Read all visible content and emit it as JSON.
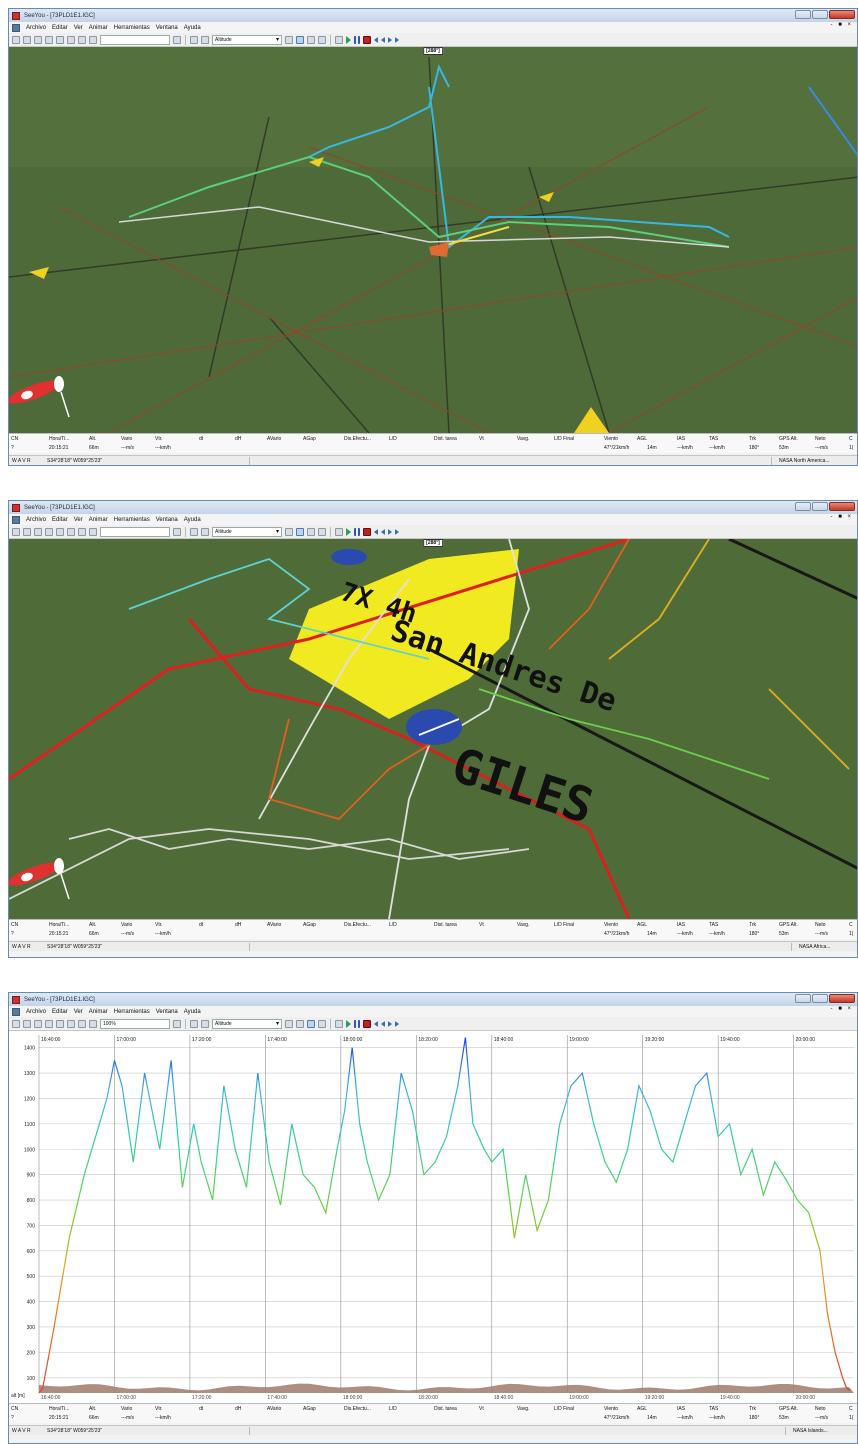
{
  "window": {
    "title": "SeeYou - [73PLD1E1.IGC]",
    "menu": [
      "Archivo",
      "Editar",
      "Ver",
      "Animar",
      "Herramientas",
      "Ventana",
      "Ayuda"
    ],
    "mdi_controls": "- ■ ×",
    "altitude_select": "Altitude",
    "zoom_value": "100%",
    "heading_label": "[288°]"
  },
  "flight_grid": {
    "headers": [
      "CN",
      "Hora/Ti...",
      "Alt.",
      "Vario",
      "Vtr.",
      "dt",
      "dH",
      "AVario",
      "AGap",
      "Dis.Efectu...",
      "L/D",
      "Dist. tarea",
      "Vt",
      "Vavg.",
      "L/D Final",
      "Viento",
      "AGL",
      "IAS",
      "TAS",
      "Trk",
      "GPS Alt.",
      "Neto",
      "C"
    ],
    "row": [
      "?",
      "20:15:21",
      "66m",
      "---m/s",
      "---km/h",
      "",
      "",
      "",
      "",
      "",
      "",
      "",
      "",
      "",
      "",
      "47°/21km/h",
      "14m",
      "---km/h",
      "---km/h",
      "180°",
      "53m",
      "---m/s",
      "1("
    ]
  },
  "status": {
    "modes": "W  A  V  R",
    "coords": "S34°28'18\"  W059°25'23\"",
    "panels": [
      "NASA North America...",
      "NASA Africa...",
      "NASA Islands..."
    ]
  },
  "map_labels": {
    "big1": "7X 4h",
    "big2": "San Andres De",
    "big3": "GILES"
  },
  "chart_data": {
    "type": "line",
    "title": "",
    "xlabel": "",
    "ylabel": "alt [m]",
    "x_ticks": [
      "16:40:00",
      "17:00:00",
      "17:20:00",
      "17:40:00",
      "18:00:00",
      "18:20:00",
      "18:40:00",
      "19:00:00",
      "19:20:00",
      "19:40:00",
      "20:00:00"
    ],
    "y_ticks": [
      100,
      200,
      300,
      400,
      500,
      600,
      700,
      800,
      900,
      1000,
      1100,
      1200,
      1300,
      1400
    ],
    "ylim": [
      40,
      1450
    ],
    "grid": true,
    "x": [
      "16:40",
      "16:41",
      "16:44",
      "16:48",
      "16:52",
      "16:54",
      "16:56",
      "16:58",
      "17:00",
      "17:02",
      "17:05",
      "17:08",
      "17:10",
      "17:12",
      "17:15",
      "17:18",
      "17:21",
      "17:23",
      "17:26",
      "17:29",
      "17:32",
      "17:35",
      "17:38",
      "17:41",
      "17:44",
      "17:47",
      "17:50",
      "17:53",
      "17:56",
      "17:59",
      "18:01",
      "18:03",
      "18:05",
      "18:07",
      "18:10",
      "18:13",
      "18:16",
      "18:19",
      "18:22",
      "18:25",
      "18:28",
      "18:31",
      "18:33",
      "18:35",
      "18:38",
      "18:40",
      "18:43",
      "18:46",
      "18:49",
      "18:52",
      "18:55",
      "18:58",
      "19:01",
      "19:04",
      "19:07",
      "19:10",
      "19:13",
      "19:16",
      "19:19",
      "19:22",
      "19:25",
      "19:28",
      "19:31",
      "19:34",
      "19:37",
      "19:40",
      "19:43",
      "19:46",
      "19:49",
      "19:52",
      "19:55",
      "19:58",
      "20:01",
      "20:04",
      "20:07",
      "20:09",
      "20:11",
      "20:13",
      "20:14",
      "20:15"
    ],
    "series": [
      {
        "values": [
          40,
          60,
          300,
          650,
          900,
          1000,
          1100,
          1200,
          1350,
          1250,
          950,
          1300,
          1150,
          1000,
          1350,
          850,
          1100,
          950,
          800,
          1250,
          1000,
          850,
          1300,
          950,
          780,
          1100,
          900,
          850,
          750,
          1000,
          1150,
          1400,
          1100,
          950,
          800,
          900,
          1300,
          1150,
          900,
          950,
          1050,
          1250,
          1440,
          1100,
          1000,
          950,
          1000,
          650,
          900,
          680,
          800,
          1100,
          1250,
          1300,
          1100,
          950,
          870,
          1000,
          1250,
          1150,
          1000,
          950,
          1100,
          1250,
          1300,
          1050,
          1100,
          900,
          1000,
          820,
          950,
          880,
          800,
          750,
          600,
          350,
          200,
          100,
          60,
          50
        ]
      }
    ]
  }
}
